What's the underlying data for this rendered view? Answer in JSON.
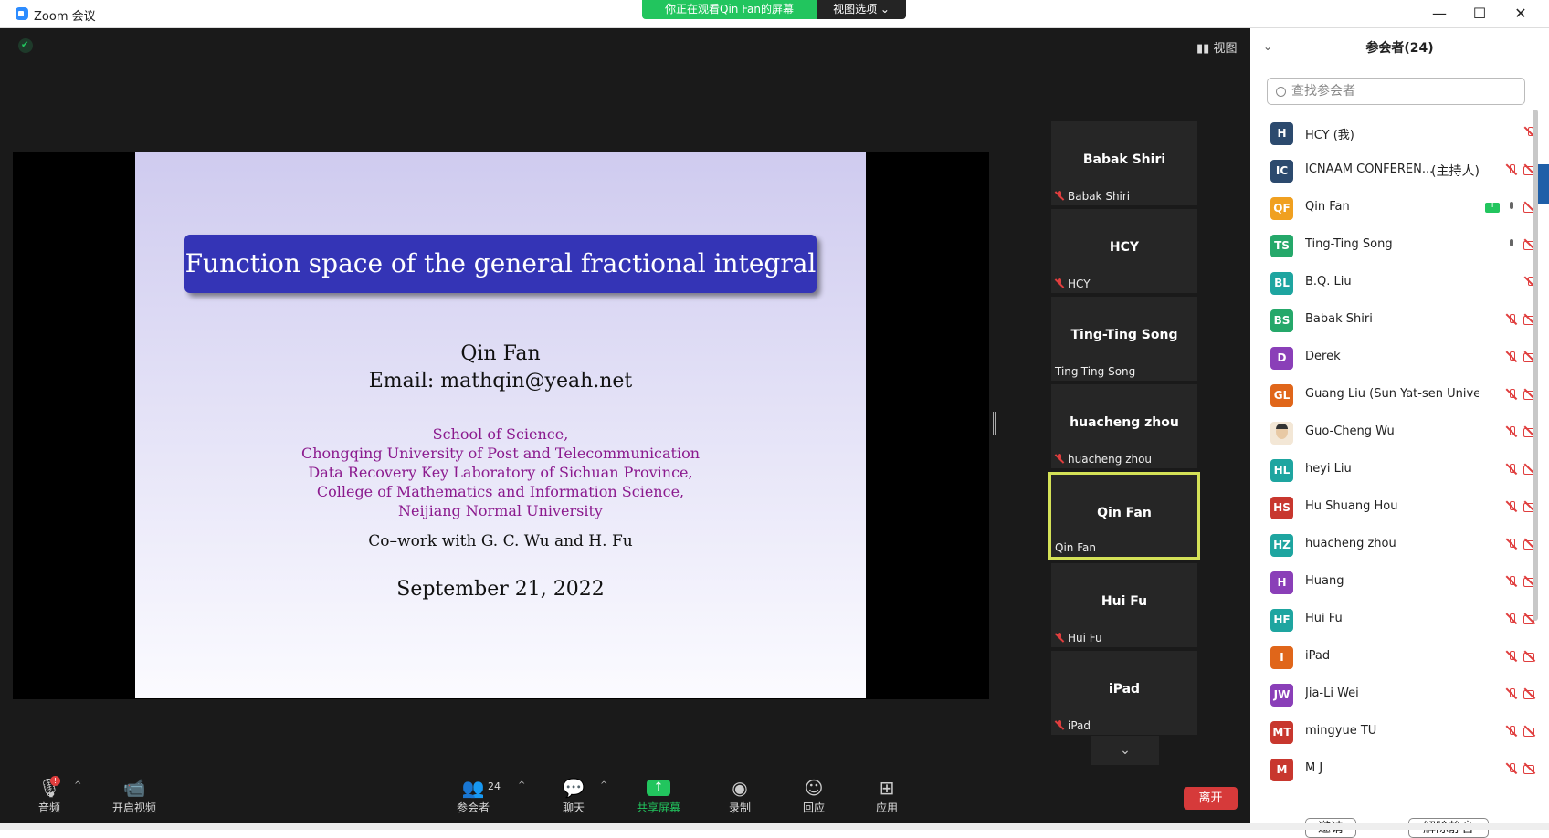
{
  "window": {
    "title": "Zoom 会议",
    "minimize": "—",
    "maximize": "☐",
    "close": "✕"
  },
  "share_banner": {
    "viewing": "你正在观看Qin  Fan的屏幕",
    "view_options": "视图选项 ⌄"
  },
  "view_button": "▮▮ 视图",
  "slide": {
    "title": "Function space of the general fractional integral",
    "author": "Qin Fan",
    "email": "Email: mathqin@yeah.net",
    "affiliation": [
      "School of Science,",
      "Chongqing University of Post and Telecommunication",
      "Data Recovery Key Laboratory of Sichuan Province,",
      "College of Mathematics and Information Science,",
      "Neijiang Normal University"
    ],
    "cowork": "Co–work with G. C. Wu and H. Fu",
    "date": "September 21, 2022"
  },
  "gallery": [
    {
      "name": "Babak Shiri",
      "label": "Babak Shiri",
      "muted": true,
      "active": false
    },
    {
      "name": "HCY",
      "label": "HCY",
      "muted": true,
      "active": false
    },
    {
      "name": "Ting-Ting Song",
      "label": "Ting-Ting Song",
      "muted": false,
      "active": false
    },
    {
      "name": "huacheng zhou",
      "label": "huacheng zhou",
      "muted": true,
      "active": false
    },
    {
      "name": "Qin Fan",
      "label": "Qin Fan",
      "muted": false,
      "active": true
    },
    {
      "name": "Hui Fu",
      "label": "Hui Fu",
      "muted": true,
      "active": false
    },
    {
      "name": "iPad",
      "label": "iPad",
      "muted": true,
      "active": false
    }
  ],
  "gallery_down": "⌄",
  "toolbar": {
    "audio": "音频",
    "audio_badge": "!",
    "video": "开启视频",
    "participants": "参会者",
    "participants_count": "24",
    "chat": "聊天",
    "share": "共享屏幕",
    "record": "录制",
    "reactions": "回应",
    "apps": "应用",
    "leave": "离开",
    "caret": "^"
  },
  "panel": {
    "title": "参会者(24)",
    "collapse": "⌄",
    "search_placeholder": "查找参会者",
    "invite": "邀请",
    "unmute": "解除静音"
  },
  "participants": [
    {
      "initials": "H",
      "name": "HCY (我)",
      "tag": "",
      "color": "#2c4a6e",
      "mic": "off",
      "cam": "none",
      "share": false
    },
    {
      "initials": "IC",
      "name": "ICNAAM CONFEREN...",
      "tag": "(主持人)",
      "color": "#2c4a6e",
      "mic": "off",
      "cam": "off",
      "share": false
    },
    {
      "initials": "QF",
      "name": "Qin Fan",
      "tag": "",
      "color": "#f0a020",
      "mic": "on",
      "cam": "off",
      "share": true
    },
    {
      "initials": "TS",
      "name": "Ting-Ting Song",
      "tag": "",
      "color": "#25a86a",
      "mic": "on",
      "cam": "off",
      "share": false
    },
    {
      "initials": "BL",
      "name": "B.Q. Liu",
      "tag": "",
      "color": "#1ea5a0",
      "mic": "off",
      "cam": "none",
      "share": false
    },
    {
      "initials": "BS",
      "name": "Babak Shiri",
      "tag": "",
      "color": "#25a86a",
      "mic": "off",
      "cam": "off",
      "share": false
    },
    {
      "initials": "D",
      "name": "Derek",
      "tag": "",
      "color": "#8a3fb8",
      "mic": "off",
      "cam": "off",
      "share": false
    },
    {
      "initials": "GL",
      "name": "Guang Liu (Sun Yat-sen Univers...",
      "tag": "",
      "color": "#e0661a",
      "mic": "off",
      "cam": "off",
      "share": false
    },
    {
      "initials": "",
      "name": "Guo-Cheng Wu",
      "tag": "",
      "color": "photo",
      "mic": "off",
      "cam": "off",
      "share": false
    },
    {
      "initials": "HL",
      "name": "heyi Liu",
      "tag": "",
      "color": "#1ea5a0",
      "mic": "off",
      "cam": "off",
      "share": false
    },
    {
      "initials": "HS",
      "name": "Hu Shuang Hou",
      "tag": "",
      "color": "#c8372e",
      "mic": "off",
      "cam": "off",
      "share": false
    },
    {
      "initials": "HZ",
      "name": "huacheng zhou",
      "tag": "",
      "color": "#1ea5a0",
      "mic": "off",
      "cam": "off",
      "share": false
    },
    {
      "initials": "H",
      "name": "Huang",
      "tag": "",
      "color": "#8a3fb8",
      "mic": "off",
      "cam": "off",
      "share": false
    },
    {
      "initials": "HF",
      "name": "Hui Fu",
      "tag": "",
      "color": "#1ea5a0",
      "mic": "off",
      "cam": "off",
      "share": false
    },
    {
      "initials": "I",
      "name": "iPad",
      "tag": "",
      "color": "#e0661a",
      "mic": "off",
      "cam": "off",
      "share": false
    },
    {
      "initials": "JW",
      "name": "Jia-Li Wei",
      "tag": "",
      "color": "#8a3fb8",
      "mic": "off",
      "cam": "off",
      "share": false
    },
    {
      "initials": "MT",
      "name": "mingyue TU",
      "tag": "",
      "color": "#c8372e",
      "mic": "off",
      "cam": "off",
      "share": false
    },
    {
      "initials": "M",
      "name": "M J",
      "tag": "",
      "color": "#c8372e",
      "mic": "off",
      "cam": "off",
      "share": false
    }
  ]
}
